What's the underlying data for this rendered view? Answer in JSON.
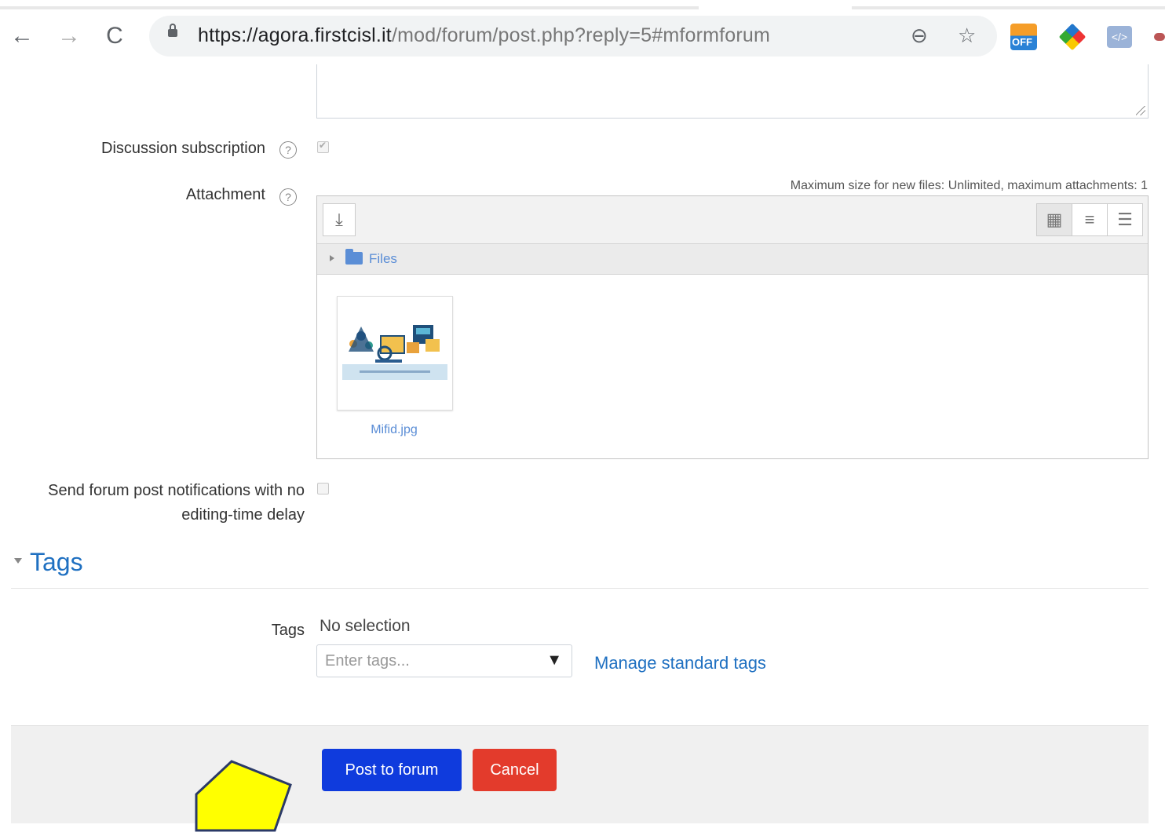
{
  "browser": {
    "url_host": "https://agora.firstcisl.it",
    "url_path": "/mod/forum/post.php?reply=5#mformforum",
    "back_icon": "arrow-left-icon",
    "forward_icon": "arrow-right-icon",
    "reload_icon": "reload-icon",
    "zoom_icon": "zoom-out-icon",
    "bookmark_icon": "star-icon",
    "extension_badge": "OFF"
  },
  "form": {
    "discussion_subscription_label": "Discussion subscription",
    "discussion_subscription_checked": true,
    "attachment_label": "Attachment",
    "attachment_limits": "Maximum size for new files: Unlimited, maximum attachments: 1",
    "files_path_label": "Files",
    "files": [
      {
        "name": "Mifid.jpg"
      }
    ],
    "notify_label_line1": "Send forum post notifications with no",
    "notify_label_line2": "editing-time delay",
    "notify_checked": false
  },
  "tags": {
    "section_title": "Tags",
    "field_label": "Tags",
    "selection_text": "No selection",
    "input_placeholder": "Enter tags...",
    "manage_link": "Manage standard tags"
  },
  "actions": {
    "post_label": "Post to forum",
    "cancel_label": "Cancel"
  },
  "colors": {
    "primary": "#0f3bdd",
    "danger": "#e33b2c",
    "link": "#1f70c1",
    "annotation_arrow": "#ffff00"
  }
}
